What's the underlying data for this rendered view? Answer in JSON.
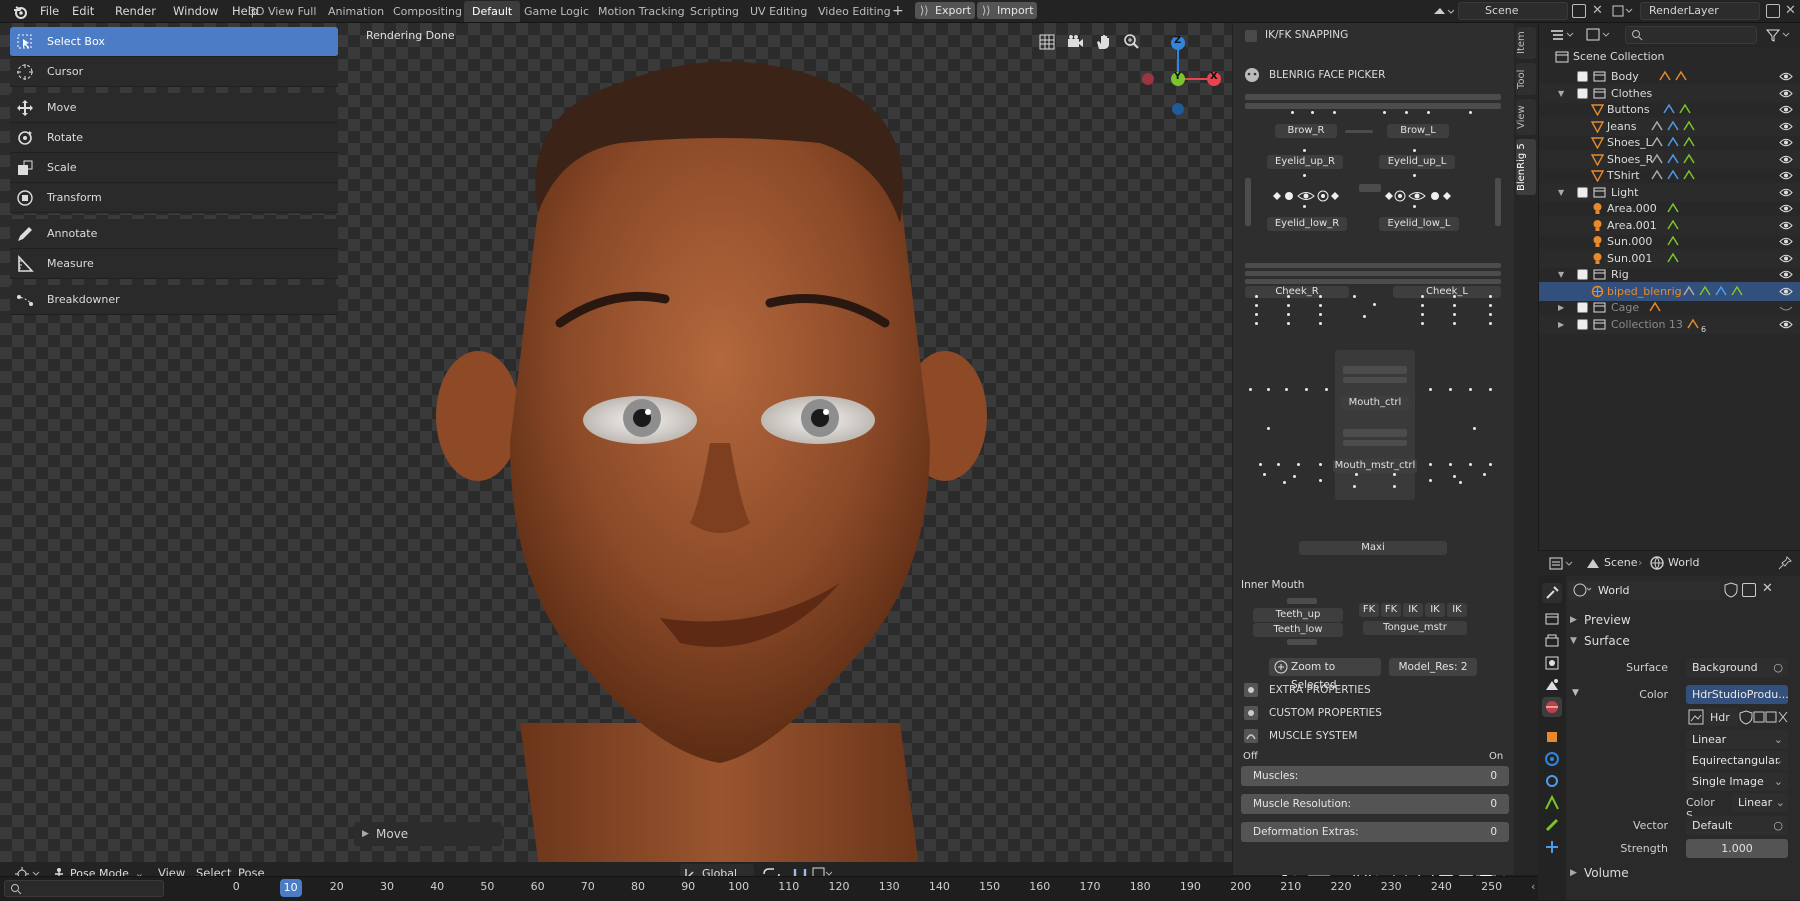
{
  "topbar": {
    "menus": [
      "File",
      "Edit",
      "Render",
      "Window",
      "Help"
    ],
    "workspaces": [
      "3D View Full",
      "Animation",
      "Compositing",
      "Default",
      "Game Logic",
      "Motion Tracking",
      "Scripting",
      "UV Editing",
      "Video Editing"
    ],
    "active_workspace": "Default",
    "export_label": "Export",
    "import_label": "Import",
    "scene": "Scene",
    "render_layer": "RenderLayer"
  },
  "toolbar": {
    "tools": [
      "Select Box",
      "Cursor",
      "Move",
      "Rotate",
      "Scale",
      "Transform",
      "Annotate",
      "Measure",
      "Breakdowner"
    ]
  },
  "viewport": {
    "status": "Rendering Done",
    "last_op": "Move",
    "axes": {
      "z": "Z",
      "y": "Y",
      "x": "X"
    },
    "header": {
      "mode": "Pose Mode",
      "menus": [
        "View",
        "Select",
        "Pose"
      ],
      "orientation": "Global"
    }
  },
  "npanel": {
    "tabs": [
      "Item",
      "Tool",
      "View",
      "BlenRig 5"
    ],
    "ikfk": "IK/FK SNAPPING",
    "face_picker": "BLENRIG FACE PICKER",
    "brow_r": "Brow_R",
    "brow_l": "Brow_L",
    "eyelid_up_r": "Eyelid_up_R",
    "eyelid_up_l": "Eyelid_up_L",
    "eyelid_low_r": "Eyelid_low_R",
    "eyelid_low_l": "Eyelid_low_L",
    "cheek_r": "Cheek_R",
    "cheek_l": "Cheek_L",
    "mouth_ctrl": "Mouth_ctrl",
    "mouth_mstr": "Mouth_mstr_ctrl",
    "maxi": "Maxi",
    "inner_mouth": "Inner Mouth",
    "teeth_up": "Teeth_up",
    "teeth_low": "Teeth_low",
    "fk_ik": [
      "FK",
      "FK",
      "IK",
      "IK",
      "IK"
    ],
    "tongue": "Tongue_mstr",
    "zoom": "Zoom to Selected",
    "model_res": "Model_Res: 2",
    "extra": "EXTRA PROPERTIES",
    "custom": "CUSTOM PROPERTIES",
    "muscle": "MUSCLE SYSTEM",
    "off": "Off",
    "on": "On",
    "muscles_label": "Muscles:",
    "muscles_value": "0",
    "res_label": "Muscle Resolution:",
    "res_value": "0",
    "deform_label": "Deformation Extras:",
    "deform_value": "0"
  },
  "outliner": {
    "root": "Scene Collection",
    "rows": [
      {
        "name": "Body",
        "level": 1
      },
      {
        "name": "Clothes",
        "level": 1
      },
      {
        "name": "Buttons",
        "level": 2
      },
      {
        "name": "Jeans",
        "level": 2
      },
      {
        "name": "Shoes_L",
        "level": 2
      },
      {
        "name": "Shoes_R",
        "level": 2
      },
      {
        "name": "TShirt",
        "level": 2
      },
      {
        "name": "Light",
        "level": 1
      },
      {
        "name": "Area.000",
        "level": 2
      },
      {
        "name": "Area.001",
        "level": 2
      },
      {
        "name": "Sun.000",
        "level": 2
      },
      {
        "name": "Sun.001",
        "level": 2
      },
      {
        "name": "Rig",
        "level": 1
      },
      {
        "name": "biped_blenrig",
        "level": 2
      },
      {
        "name": "Cage",
        "level": 1
      },
      {
        "name": "Collection 13",
        "level": 1
      }
    ],
    "collection13_badge": "6"
  },
  "properties": {
    "breadcrumb_scene": "Scene",
    "breadcrumb_world": "World",
    "world_name": "World",
    "preview": "Preview",
    "surface": "Surface",
    "surface_label": "Surface",
    "surface_value": "Background",
    "color_label": "Color",
    "color_value": "HdrStudioProdu...",
    "hdr": "Hdr",
    "interp": "Linear",
    "projection": "Equirectangular",
    "source": "Single Image",
    "colorspace_label": "Color S..",
    "colorspace_value": "Linear",
    "vector_label": "Vector",
    "vector_value": "Default",
    "strength_label": "Strength",
    "strength_value": "1.000",
    "volume": "Volume"
  },
  "timeline": {
    "current_frame": "10",
    "ticks": [
      "0",
      "10",
      "20",
      "30",
      "40",
      "50",
      "60",
      "70",
      "80",
      "90",
      "100",
      "110",
      "120",
      "130",
      "140",
      "150",
      "160",
      "170",
      "180",
      "190",
      "200",
      "210",
      "220",
      "230",
      "240",
      "250"
    ]
  },
  "colors": {
    "accent": "#4b7cc5",
    "orange": "#e88a2c",
    "selected_row": "#33507d",
    "x_axis": "#e8434f",
    "y_axis": "#7ac629",
    "z_axis": "#2e86e0"
  }
}
